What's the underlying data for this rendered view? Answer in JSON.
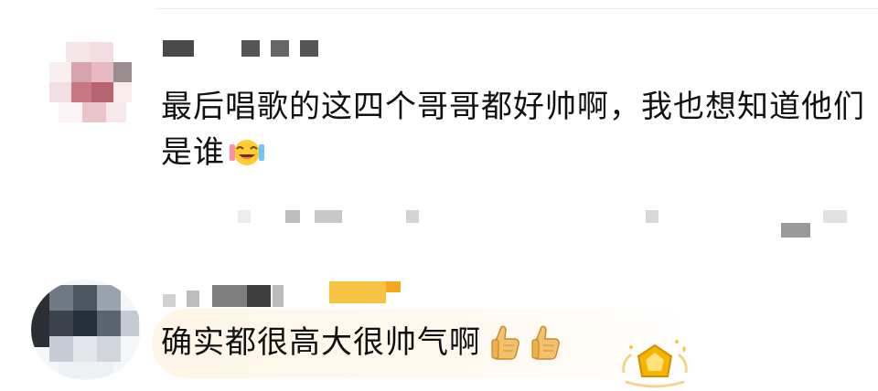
{
  "comments": [
    {
      "text": "最后唱歌的这四个哥哥都好帅啊，我也想知道他们是谁",
      "emoji": "laughing-crying-emoji"
    },
    {
      "text": "确实都很高大很帅气啊",
      "emoji": "thumbs-up-emoji",
      "badge": "crown-gem-badge"
    }
  ],
  "colors": {
    "text": "#111111",
    "divider": "#ececec",
    "highlight_bubble": "#fff6e8",
    "badge_gold": "#f5b400"
  }
}
